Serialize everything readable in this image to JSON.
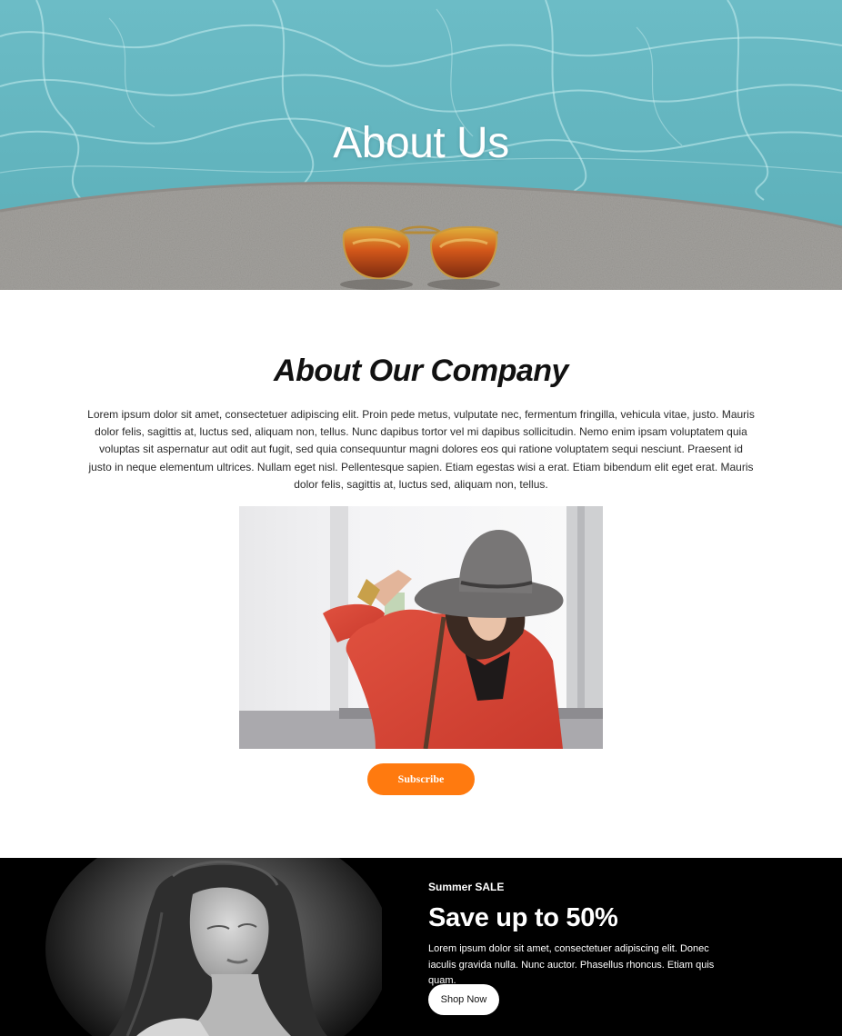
{
  "hero": {
    "title": "About Us"
  },
  "about": {
    "heading": "About Our Company",
    "body": "Lorem ipsum dolor sit amet, consectetuer adipiscing elit. Proin pede metus, vulputate nec, fermentum fringilla, vehicula vitae, justo. Mauris dolor felis, sagittis at, luctus sed, aliquam non, tellus. Nunc dapibus tortor vel mi dapibus sollicitudin. Nemo enim ipsam voluptatem quia voluptas sit aspernatur aut odit aut fugit, sed quia consequuntur magni dolores eos qui ratione voluptatem sequi nesciunt. Praesent id justo in neque elementum ultrices. Nullam eget nisl. Pellentesque sapien. Etiam egestas wisi a erat. Etiam bibendum elit eget erat. Mauris dolor felis, sagittis at, luctus sed, aliquam non, tellus.",
    "subscribe_label": "Subscribe"
  },
  "sale": {
    "kicker": "Summer SALE",
    "title": "Save up to 50%",
    "body": "Lorem ipsum dolor sit amet, consectetuer adipiscing elit. Donec iaculis gravida nulla. Nunc auctor. Phasellus rhoncus. Etiam quis quam.",
    "shop_label": "Shop Now"
  },
  "colors": {
    "accent": "#ff7a0f",
    "pool": "#5fb3bd",
    "sale_bg": "#000000"
  }
}
